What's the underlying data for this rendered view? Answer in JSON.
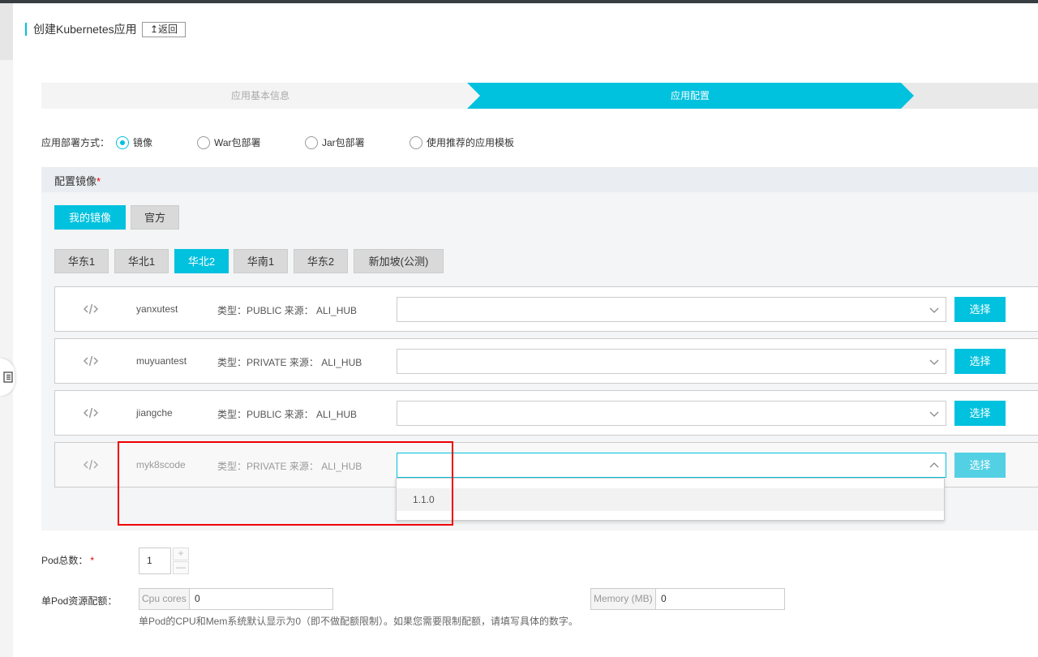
{
  "header": {
    "title": "创建Kubernetes应用",
    "back_label": "返回"
  },
  "steps": [
    {
      "label": "应用基本信息",
      "state": "done"
    },
    {
      "label": "应用配置",
      "state": "active"
    },
    {
      "label": "",
      "state": "pending"
    }
  ],
  "deploy": {
    "label": "应用部署方式：",
    "options": [
      {
        "label": "镜像",
        "checked": true
      },
      {
        "label": "War包部署",
        "checked": false
      },
      {
        "label": "Jar包部署",
        "checked": false
      },
      {
        "label": "使用推荐的应用模板",
        "checked": false
      }
    ]
  },
  "image_config": {
    "title": "配置镜像",
    "required_mark": "*",
    "source_tabs": [
      {
        "label": "我的镜像",
        "active": true
      },
      {
        "label": "官方",
        "active": false
      }
    ],
    "region_tabs": [
      {
        "label": "华东1",
        "active": false
      },
      {
        "label": "华北1",
        "active": false
      },
      {
        "label": "华北2",
        "active": true
      },
      {
        "label": "华南1",
        "active": false
      },
      {
        "label": "华东2",
        "active": false
      },
      {
        "label": "新加坡(公测)",
        "active": false
      }
    ],
    "repos": [
      {
        "name": "yanxutest",
        "meta": "类型：PUBLIC 来源： ALI_HUB",
        "select_value": "",
        "button": "选择",
        "open": false
      },
      {
        "name": "muyuantest",
        "meta": "类型：PRIVATE 来源： ALI_HUB",
        "select_value": "",
        "button": "选择",
        "open": false
      },
      {
        "name": "jiangche",
        "meta": "类型：PUBLIC 来源： ALI_HUB",
        "select_value": "",
        "button": "选择",
        "open": false
      },
      {
        "name": "myk8scode",
        "meta": "类型：PRIVATE 来源： ALI_HUB",
        "select_value": "",
        "button": "选择",
        "open": true
      }
    ],
    "dropdown_options": [
      "1.1.0"
    ]
  },
  "pod": {
    "label": "Pod总数：",
    "required_mark": "*",
    "value": "1",
    "plus": "+",
    "minus": "—"
  },
  "resources": {
    "label": "单Pod资源配额：",
    "cpu_prefix": "Cpu cores",
    "cpu_value": "0",
    "mem_prefix": "Memory (MB)",
    "mem_value": "0",
    "hint": "单Pod的CPU和Mem系统默认显示为0（即不做配额限制）。如果您需要限制配额，请填写具体的数字。"
  },
  "colors": {
    "accent": "#00c1de",
    "highlight": "#e00000"
  }
}
